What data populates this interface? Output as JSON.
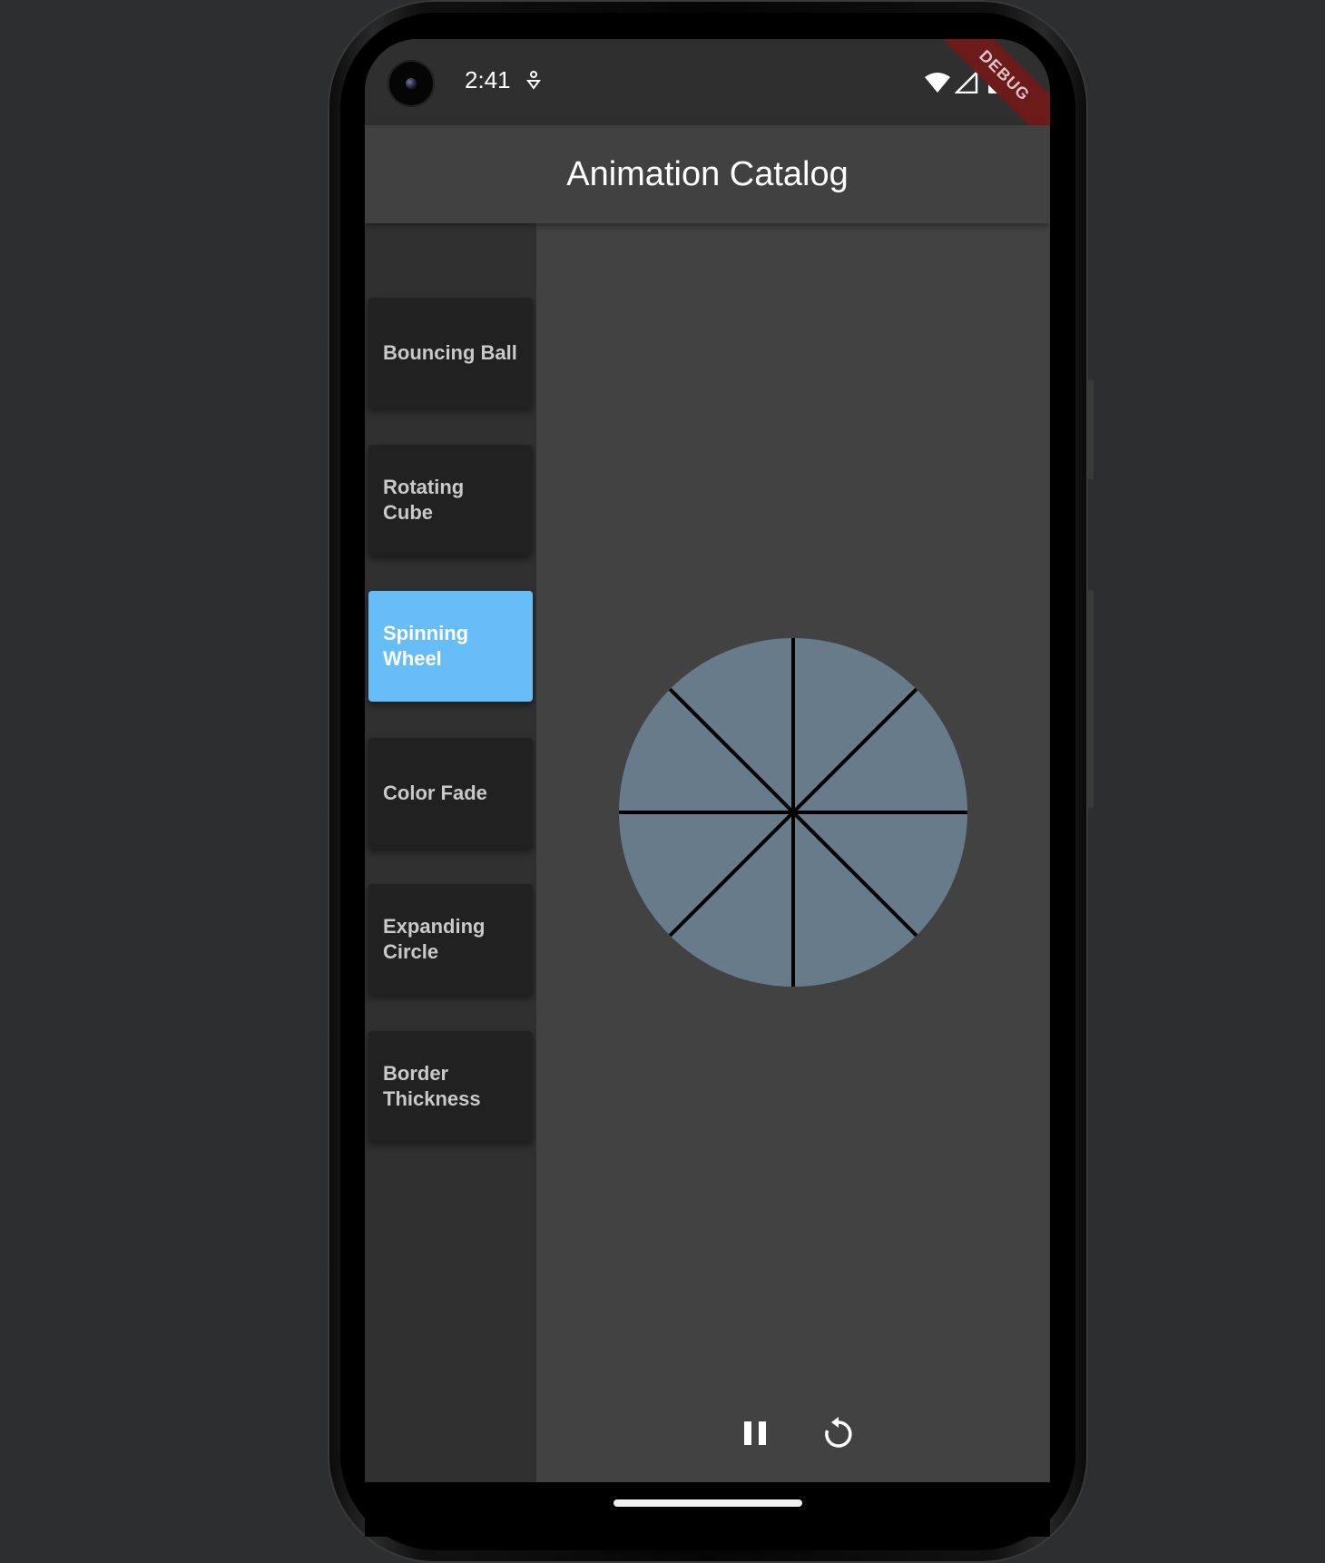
{
  "status_bar": {
    "time": "2:41"
  },
  "debug_banner": "DEBUG",
  "app_bar": {
    "title": "Animation Catalog"
  },
  "sidebar": {
    "items": [
      {
        "label": "Bouncing Ball",
        "selected": false
      },
      {
        "label": "Rotating Cube",
        "selected": false
      },
      {
        "label": "Spinning Wheel",
        "selected": true
      },
      {
        "label": "Color Fade",
        "selected": false
      },
      {
        "label": "Expanding Circle",
        "selected": false
      },
      {
        "label": "Border Thickness",
        "selected": false
      }
    ]
  },
  "animation": {
    "name": "Spinning Wheel",
    "spoke_count": 8,
    "wheel_color": "#677b8a",
    "spoke_color": "#000000"
  },
  "controls": {
    "pause_icon": "pause-icon",
    "replay_icon": "replay-icon"
  },
  "colors": {
    "accent": "#67bdf7",
    "background": "#2d2e30",
    "appbar": "#414141",
    "content": "#424242"
  }
}
